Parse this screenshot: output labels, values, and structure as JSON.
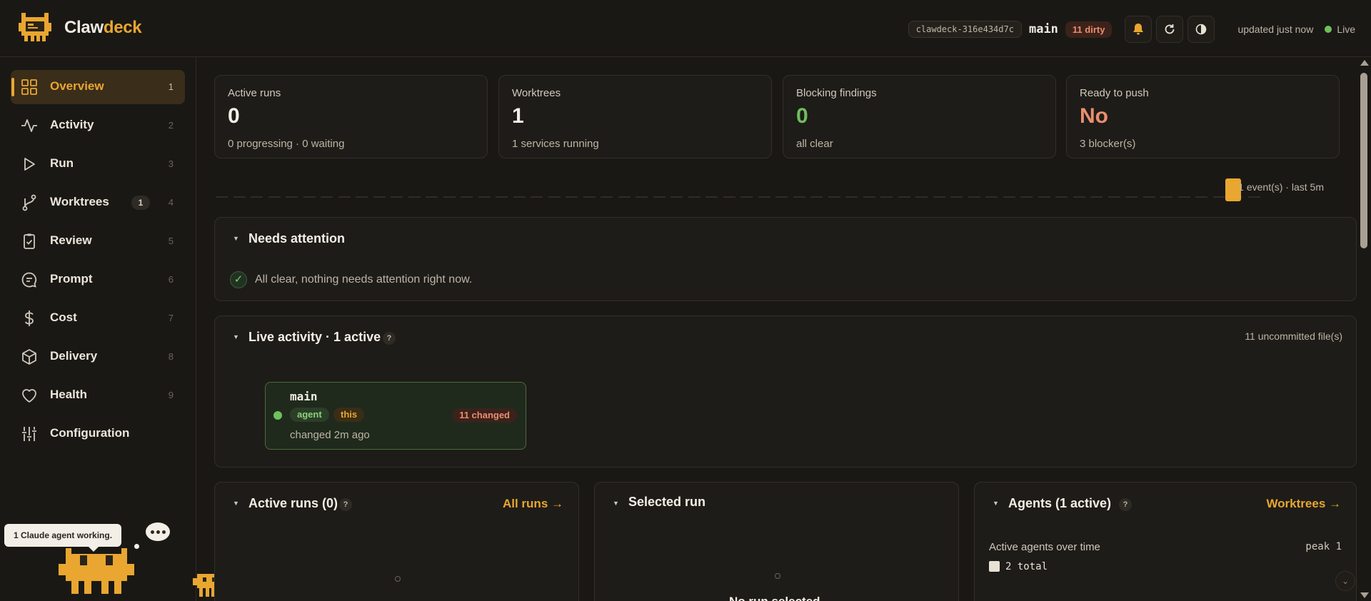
{
  "brand": {
    "name_a": "Claw",
    "name_b": "deck"
  },
  "topbar": {
    "hash": "clawdeck-316e434d7c",
    "branch": "main",
    "dirty": "11 dirty",
    "updated": "updated just now",
    "live": "Live"
  },
  "sidebar": {
    "items": [
      {
        "label": "Overview",
        "num": "1",
        "icon": "grid-icon",
        "active": true
      },
      {
        "label": "Activity",
        "num": "2",
        "icon": "pulse-icon"
      },
      {
        "label": "Run",
        "num": "3",
        "icon": "play-icon"
      },
      {
        "label": "Worktrees",
        "num": "4",
        "icon": "branch-icon",
        "badge": "1"
      },
      {
        "label": "Review",
        "num": "5",
        "icon": "clipboard-check-icon"
      },
      {
        "label": "Prompt",
        "num": "6",
        "icon": "chat-icon"
      },
      {
        "label": "Cost",
        "num": "7",
        "icon": "dollar-icon"
      },
      {
        "label": "Delivery",
        "num": "8",
        "icon": "box-icon"
      },
      {
        "label": "Health",
        "num": "9",
        "icon": "heart-icon"
      },
      {
        "label": "Configuration",
        "num": "",
        "icon": "sliders-icon"
      }
    ],
    "mascot_speech": "1 Claude agent working."
  },
  "stats": [
    {
      "label": "Active runs",
      "value": "0",
      "sub": "0 progressing · 0 waiting"
    },
    {
      "label": "Worktrees",
      "value": "1",
      "sub": "1 services running"
    },
    {
      "label": "Blocking findings",
      "value": "0",
      "sub": "all clear"
    },
    {
      "label": "Ready to push",
      "value": "No",
      "sub": "3 blocker(s)"
    }
  ],
  "timeline": {
    "label": "1 event(s) · last 5m"
  },
  "attention": {
    "title": "Needs attention",
    "message": "All clear, nothing needs attention right now."
  },
  "live_activity": {
    "title": "Live activity · 1 active",
    "help": "?",
    "uncommitted": "11 uncommitted file(s)",
    "card": {
      "name": "main",
      "tag_agent": "agent",
      "tag_this": "this",
      "changed": "11 changed",
      "time": "changed 2m ago"
    }
  },
  "active_runs": {
    "title": "Active runs (0)",
    "help": "?",
    "link": "All runs →"
  },
  "selected_run": {
    "title": "Selected run",
    "partial_text": "No run selected"
  },
  "agents": {
    "title": "Agents (1 active)",
    "help": "?",
    "link": "Worktrees →",
    "subtitle": "Active agents over time",
    "peak": "peak 1",
    "legend": "2 total"
  },
  "colors": {
    "accent": "#e9a630",
    "good": "#6fbf5e",
    "bad": "#e98f6f",
    "bg": "#1a1815"
  }
}
